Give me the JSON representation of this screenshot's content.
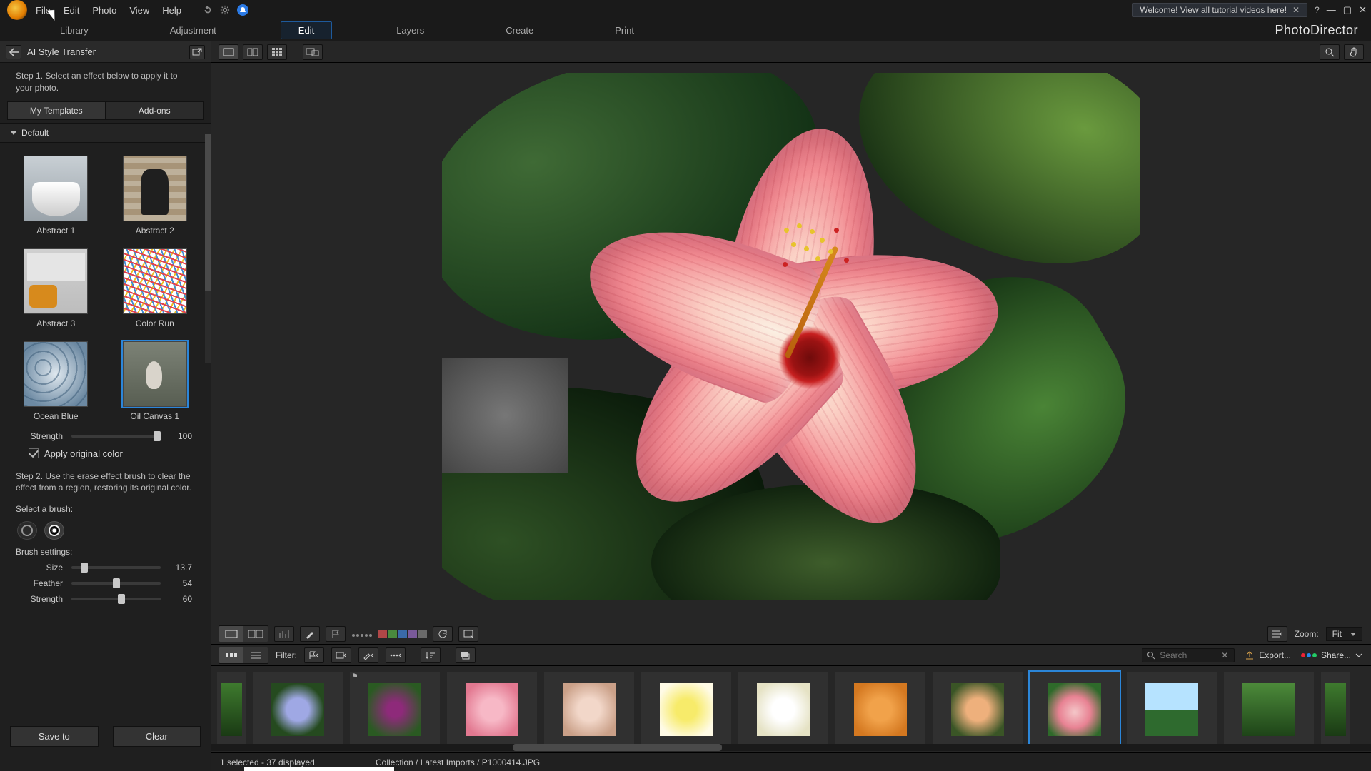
{
  "app": {
    "brand": "PhotoDirector"
  },
  "menu": [
    "File",
    "Edit",
    "Photo",
    "View",
    "Help"
  ],
  "welcome": {
    "text": "Welcome! View all tutorial videos here!"
  },
  "tabs": {
    "items": [
      "Library",
      "Adjustment",
      "Edit",
      "Layers",
      "Create",
      "Print"
    ],
    "active": 2
  },
  "panel": {
    "title": "AI Style Transfer",
    "step1": "Step 1. Select an effect below to apply it to your photo.",
    "subtabs": {
      "templates": "My Templates",
      "addons": "Add-ons"
    },
    "section": "Default",
    "templates": [
      {
        "label": "Abstract 1"
      },
      {
        "label": "Abstract 2"
      },
      {
        "label": "Abstract 3"
      },
      {
        "label": "Color Run"
      },
      {
        "label": "Ocean Blue"
      },
      {
        "label": "Oil Canvas 1",
        "selected": true
      }
    ],
    "strength": {
      "label": "Strength",
      "value": "100"
    },
    "apply_original": {
      "label": "Apply original color",
      "checked": true
    },
    "step2": "Step 2. Use the erase effect brush to clear the effect from a region, restoring its original color.",
    "select_brush": "Select a brush:",
    "brush_settings_label": "Brush settings:",
    "brush": {
      "size": {
        "label": "Size",
        "value": "13.7"
      },
      "feather": {
        "label": "Feather",
        "value": "54"
      },
      "strength": {
        "label": "Strength",
        "value": "60"
      }
    },
    "save_to": "Save to",
    "clear": "Clear"
  },
  "mid": {
    "zoom_label": "Zoom:",
    "zoom_value": "Fit",
    "color_chips": [
      "#b04747",
      "#4a8a3e",
      "#3a6aa8",
      "#7a5a9a",
      "#6a6a6a"
    ]
  },
  "filter": {
    "label": "Filter:",
    "search_placeholder": "Search",
    "export": "Export...",
    "share": "Share..."
  },
  "status": {
    "selection": "1 selected - 37 displayed",
    "path": "Collection / Latest Imports / P1000414.JPG"
  }
}
